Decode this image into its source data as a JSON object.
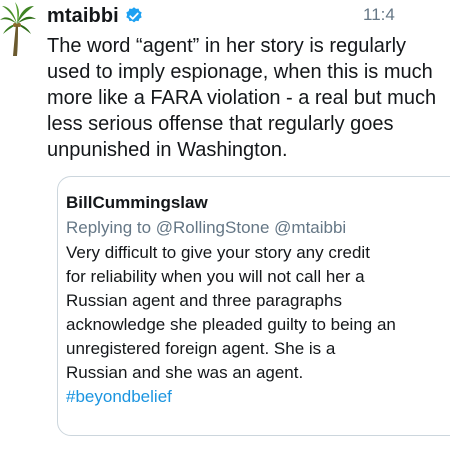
{
  "tweet": {
    "username": "mtaibbi",
    "timestamp": "11:4",
    "verified_icon": "verified-badge-icon",
    "avatar_icon": "palm-tree-avatar",
    "text_lines": [
      "The word “agent” in her story is regularly",
      "used to imply espionage, when this is much",
      "more like a FARA violation - a real but much",
      "less serious offense that regularly goes",
      "unpunished in Washington."
    ]
  },
  "quoted": {
    "author": "BillCummingslaw",
    "reply_line": "Replying to @RollingStone @mtaibbi",
    "text_lines": [
      "Very difficult to give your story any credit",
      "for reliability when you will not call her a",
      "Russian agent and three paragraphs",
      "acknowledge she pleaded guilty to being an",
      "unregistered foreign agent.  She is a",
      "Russian and she was an agent."
    ],
    "hashtag": "#beyondbelief"
  },
  "colors": {
    "text": "#14171a",
    "secondary": "#657786",
    "link": "#1b95e0",
    "verified": "#1da1f2",
    "border": "#ccd6dd"
  }
}
